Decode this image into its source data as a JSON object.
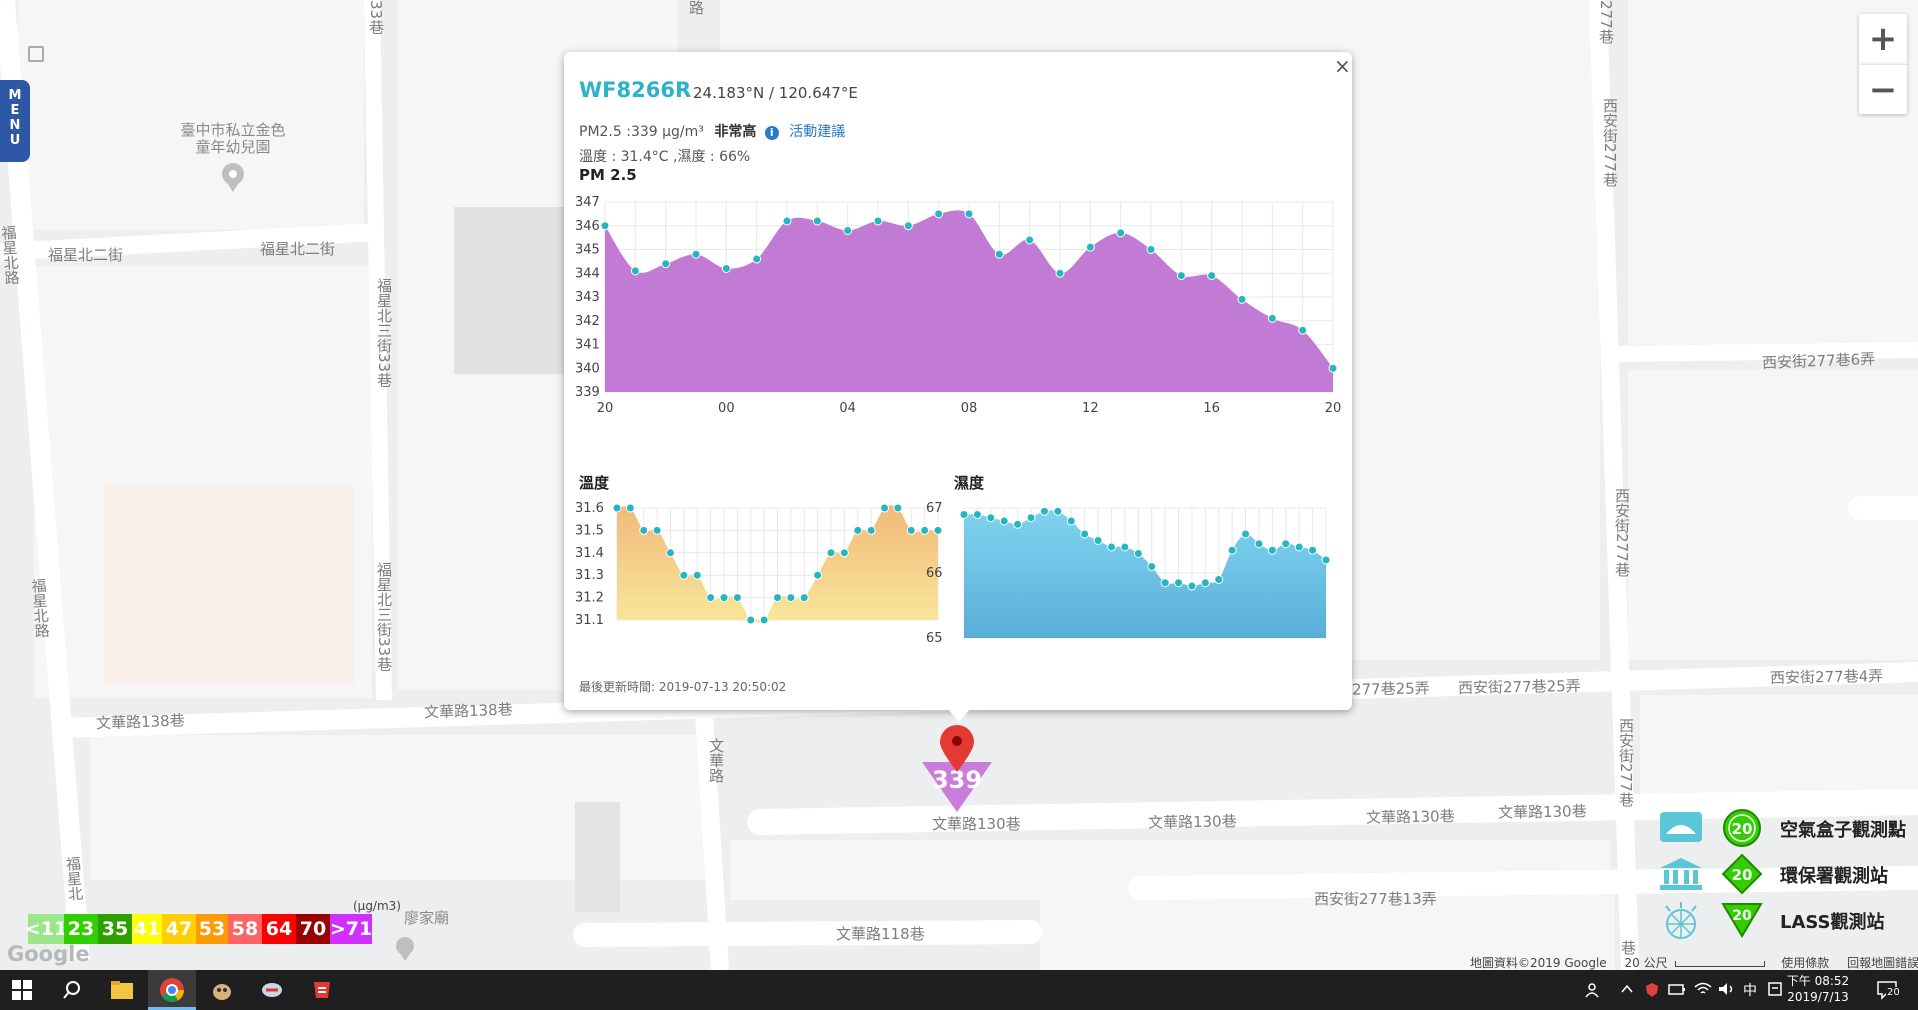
{
  "map": {
    "streets": [
      {
        "id": "fuxing-bei-2-w",
        "text": "福星北二街"
      },
      {
        "id": "fuxing-bei-2-e",
        "text": "福星北二街"
      },
      {
        "id": "wenhua-138-w",
        "text": "文華路138巷"
      },
      {
        "id": "wenhua-138-e",
        "text": "文華路138巷"
      },
      {
        "id": "wenhua-130-a",
        "text": "文華路130巷"
      },
      {
        "id": "wenhua-130-b",
        "text": "文華路130巷"
      },
      {
        "id": "wenhua-130-c",
        "text": "文華路130巷"
      },
      {
        "id": "wenhua-130-d",
        "text": "文華路130巷"
      },
      {
        "id": "wenhua-118",
        "text": "文華路118巷"
      },
      {
        "id": "xian-277-6",
        "text": "西安街277巷6弄"
      },
      {
        "id": "xian-277-25a",
        "text": "277巷25弄"
      },
      {
        "id": "xian-277-25b",
        "text": "西安街277巷25弄"
      },
      {
        "id": "xian-277-4",
        "text": "西安街277巷4弄"
      },
      {
        "id": "xian-277-13",
        "text": "西安街277巷13弄"
      },
      {
        "id": "v-fuxing-bei-road-1",
        "text": "福星北路"
      },
      {
        "id": "v-fuxing-bei-road-2",
        "text": "福星北路"
      },
      {
        "id": "v-fuxing-bei-road-3",
        "text": "福星北"
      },
      {
        "id": "v-fuxing-bei-3-33a",
        "text": "福星北三街33巷"
      },
      {
        "id": "v-fuxing-bei-3-33b",
        "text": "福星北三街33巷"
      },
      {
        "id": "v-33",
        "text": "33巷"
      },
      {
        "id": "v-wenhua",
        "text": "文華路"
      },
      {
        "id": "v-road-top",
        "text": "路"
      },
      {
        "id": "v-277-top",
        "text": "277巷"
      },
      {
        "id": "v-xian-277a",
        "text": "西安街277巷"
      },
      {
        "id": "v-xian-277b",
        "text": "西安街277巷"
      },
      {
        "id": "v-xian-277c",
        "text": "西安街277巷"
      },
      {
        "id": "v-xian-277d",
        "text": "西安街277巷"
      },
      {
        "id": "v-bottom",
        "text": "巷"
      }
    ],
    "poi_kindergarten": {
      "line1": "臺中市私立金色",
      "line2": "童年幼兒園"
    },
    "poi_temple": "廖家廟",
    "google_logo": "Google",
    "attribution": "地圖資料©2019 Google",
    "scale_label": "20 公尺",
    "terms": "使用條款",
    "report": "回報地圖錯誤",
    "marker_value": "339",
    "colors": {
      "marker": "#c77dd9",
      "pin": "#e53935"
    }
  },
  "menu": {
    "letters": [
      "M",
      "E",
      "N",
      "U"
    ]
  },
  "zoom": {
    "in": "+",
    "out": "−"
  },
  "popup": {
    "close_label": "×",
    "site_id": "WF8266R",
    "coordinates": "24.183°N / 120.647°E",
    "pm_text": "PM2.5 :339 μg/m³",
    "level": "非常高",
    "advice_icon": "i",
    "advice": "活動建議",
    "temp_humidity": "溫度 : 31.4°C ,濕度 : 66%",
    "updated": "最後更新時間: 2019-07-13 20:50:02"
  },
  "chart_data": [
    {
      "type": "area",
      "title": "PM 2.5",
      "x_ticks": [
        "20",
        "00",
        "04",
        "08",
        "12",
        "16",
        "20"
      ],
      "ylim": [
        339,
        347
      ],
      "y_ticks": [
        339,
        340,
        341,
        342,
        343,
        344,
        345,
        346,
        347
      ],
      "grid": true,
      "color": "#c27bd4",
      "marker_color": "#26b5c2",
      "values": [
        346,
        344.1,
        344.4,
        344.8,
        344.2,
        344.6,
        346.2,
        346.2,
        345.8,
        346.2,
        346,
        346.5,
        346.5,
        344.8,
        345.4,
        344,
        345.1,
        345.7,
        345,
        343.9,
        343.9,
        342.9,
        342.1,
        341.6,
        340
      ],
      "points_shown": "the full series is drawn with a marker on every point"
    },
    {
      "type": "area",
      "title": "溫度",
      "ylim": [
        31.1,
        31.6
      ],
      "y_ticks": [
        31.1,
        31.2,
        31.3,
        31.4,
        31.5,
        31.6
      ],
      "grid": true,
      "gradient": [
        "#f2b97a",
        "#f7e79a"
      ],
      "marker_color": "#26b5c2",
      "values": [
        31.6,
        31.6,
        31.5,
        31.5,
        31.4,
        31.3,
        31.3,
        31.2,
        31.2,
        31.2,
        31.1,
        31.1,
        31.2,
        31.2,
        31.2,
        31.3,
        31.4,
        31.4,
        31.5,
        31.5,
        31.6,
        31.6,
        31.5,
        31.5,
        31.5
      ]
    },
    {
      "type": "area",
      "title": "濕度",
      "ylim": [
        65,
        67
      ],
      "y_ticks": [
        65,
        66,
        67
      ],
      "grid": true,
      "gradient": [
        "#7fd3ef",
        "#5aaed8"
      ],
      "marker_color": "#26b5c2",
      "values": [
        66.9,
        66.9,
        66.85,
        66.8,
        66.75,
        66.85,
        66.95,
        66.95,
        66.8,
        66.6,
        66.5,
        66.4,
        66.4,
        66.3,
        66.1,
        65.85,
        65.85,
        65.8,
        65.85,
        65.9,
        66.35,
        66.6,
        66.45,
        66.35,
        66.45,
        66.4,
        66.35,
        66.2
      ]
    }
  ],
  "legend": {
    "unit": "(μg/m3)",
    "cells": [
      {
        "label": "<11",
        "color": "#9be58a"
      },
      {
        "label": "23",
        "color": "#31cf00"
      },
      {
        "label": "35",
        "color": "#2f9f00"
      },
      {
        "label": "41",
        "color": "#ffff00"
      },
      {
        "label": "47",
        "color": "#ffcf00"
      },
      {
        "label": "53",
        "color": "#ff9a00"
      },
      {
        "label": "58",
        "color": "#ff6464"
      },
      {
        "label": "64",
        "color": "#ff0000"
      },
      {
        "label": "70",
        "color": "#990000"
      },
      {
        "label": ">71",
        "color": "#cf30ff"
      }
    ]
  },
  "station_legend": [
    {
      "badge": "20",
      "label": "空氣盒子觀測點",
      "icon": "airbox-icon"
    },
    {
      "badge": "20",
      "label": "環保署觀測站",
      "icon": "epa-building-icon"
    },
    {
      "badge": "20",
      "label": "LASS觀測站",
      "icon": "lass-sensor-icon"
    }
  ],
  "taskbar": {
    "time": "下午 08:52",
    "date": "2019/7/13",
    "ime": "中",
    "notifications": "20"
  }
}
